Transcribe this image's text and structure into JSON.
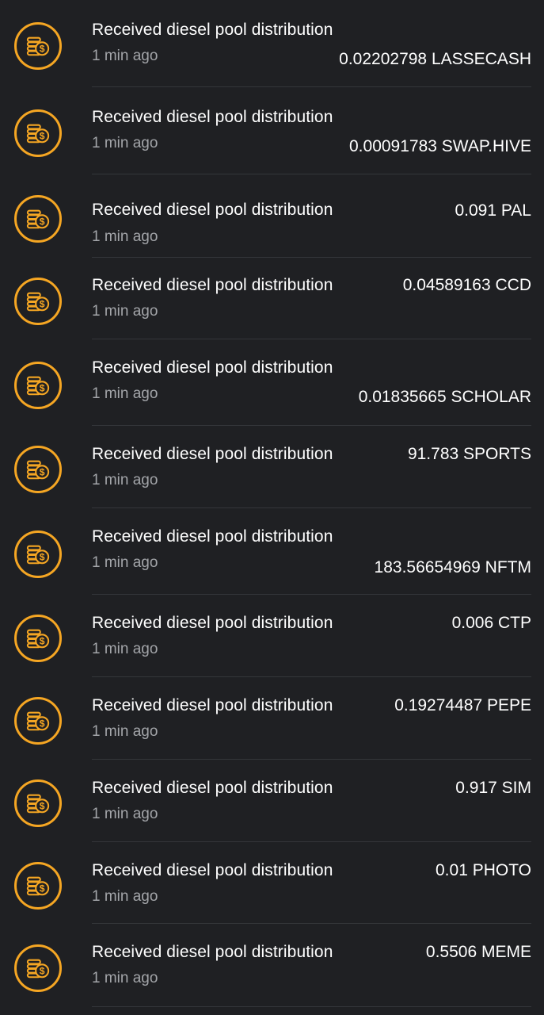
{
  "accent_color": "#f5a623",
  "icon": "coins-dollar-icon",
  "transactions": [
    {
      "title": "Received diesel pool distribution",
      "time": "1 min ago",
      "amount": "0.02202798 LASSECASH"
    },
    {
      "title": "Received diesel pool distribution",
      "time": "1 min ago",
      "amount": "0.00091783 SWAP.HIVE"
    },
    {
      "title": "Received diesel pool distribution",
      "time": "1 min ago",
      "amount": "0.091 PAL"
    },
    {
      "title": "Received diesel pool distribution",
      "time": "1 min ago",
      "amount": "0.04589163 CCD"
    },
    {
      "title": "Received diesel pool distribution",
      "time": "1 min ago",
      "amount": "0.01835665 SCHOLAR"
    },
    {
      "title": "Received diesel pool distribution",
      "time": "1 min ago",
      "amount": "91.783 SPORTS"
    },
    {
      "title": "Received diesel pool distribution",
      "time": "1 min ago",
      "amount": "183.56654969 NFTM"
    },
    {
      "title": "Received diesel pool distribution",
      "time": "1 min ago",
      "amount": "0.006 CTP"
    },
    {
      "title": "Received diesel pool distribution",
      "time": "1 min ago",
      "amount": "0.19274487 PEPE"
    },
    {
      "title": "Received diesel pool distribution",
      "time": "1 min ago",
      "amount": "0.917 SIM"
    },
    {
      "title": "Received diesel pool distribution",
      "time": "1 min ago",
      "amount": "0.01 PHOTO"
    },
    {
      "title": "Received diesel pool distribution",
      "time": "1 min ago",
      "amount": "0.5506 MEME"
    }
  ]
}
